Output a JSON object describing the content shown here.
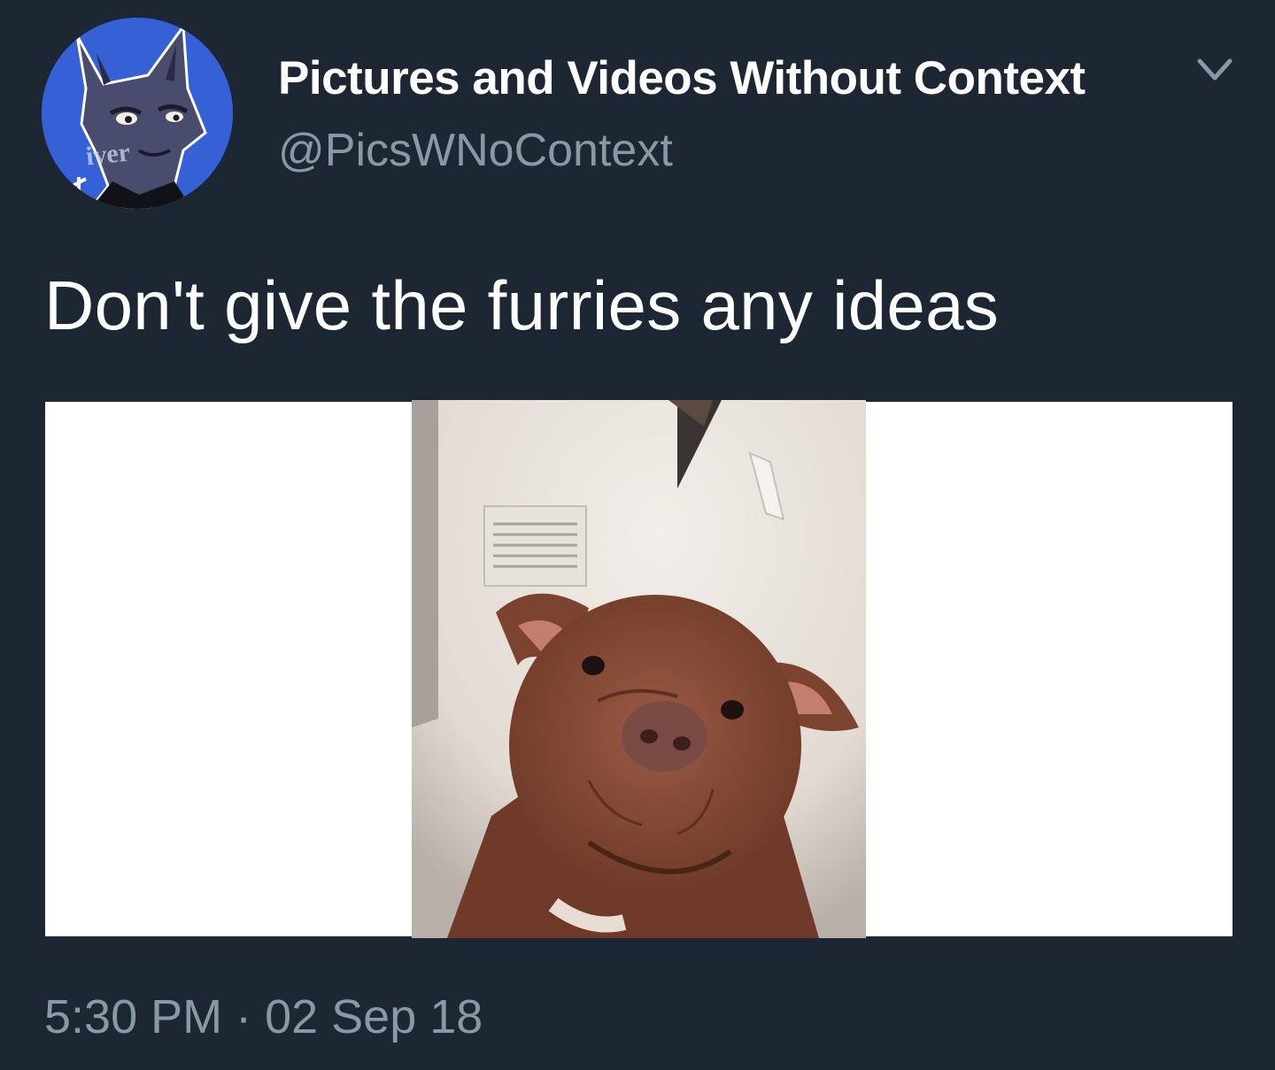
{
  "tweet": {
    "author": {
      "display_name": "Pictures and Videos Without Context",
      "handle": "@PicsWNoContext",
      "avatar_badge_text": "iver"
    },
    "text": "Don't give the furries any ideas",
    "timestamp": "5:30 PM · 02 Sep 18",
    "menu_icon": "chevron-down-icon",
    "media_icon": "dog-photo"
  },
  "colors": {
    "background": "#1c2733",
    "primary_text": "#ffffff",
    "secondary_text": "#8899a6",
    "avatar_bg": "#2f56c9"
  }
}
